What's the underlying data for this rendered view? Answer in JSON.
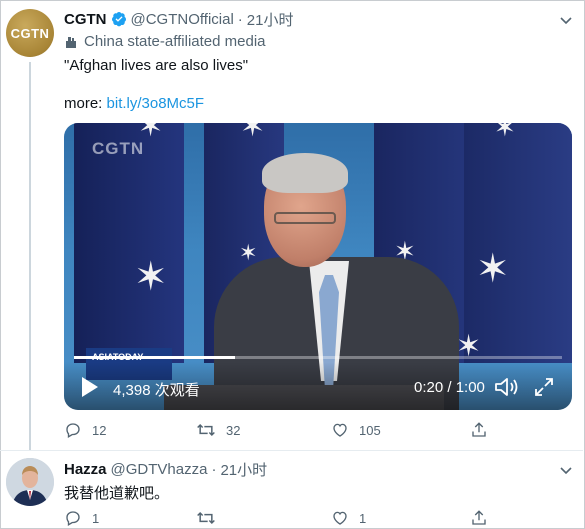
{
  "tweet1": {
    "display_name": "CGTN",
    "handle": "@CGTNOfficial",
    "time": "21小时",
    "avatar_text": "CGTN",
    "affiliation": "China state-affiliated media",
    "text": "\"Afghan lives are also lives\"",
    "more_prefix": "more: ",
    "more_link": "bit.ly/3o8Mc5F",
    "video": {
      "watermark": "CGTN",
      "badge": "ASIATODAY",
      "views": "4,398 次观看",
      "timecode": "0:20 / 1:00",
      "progress_fraction": 0.33
    },
    "actions": {
      "replies": "12",
      "retweets": "32",
      "likes": "105"
    }
  },
  "tweet2": {
    "display_name": "Hazza",
    "handle": "@GDTVhazza",
    "time": "21小时",
    "text": "我替他道歉吧。",
    "actions": {
      "replies": "1",
      "retweets": "",
      "likes": "1"
    }
  },
  "colors": {
    "link": "#1b95e0",
    "verified": "#1da1f2",
    "muted": "#536471"
  }
}
